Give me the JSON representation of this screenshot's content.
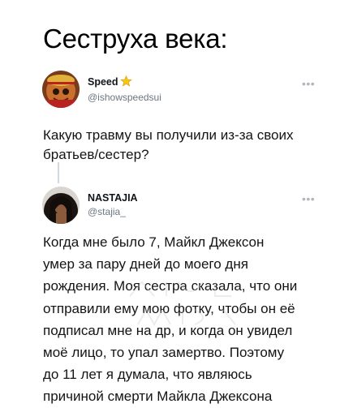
{
  "page": {
    "title": "Сеструха века:"
  },
  "post_1": {
    "display_name": "Speed",
    "badge_icon": "star-badge-icon",
    "handle": "@ishowspeedsui",
    "more_icon": "ellipsis-icon",
    "text_lines": [
      "Какую травму вы получили из-за своих",
      "братьев/сестер?"
    ]
  },
  "post_2": {
    "display_name": "NASTAJIA",
    "handle": "@stajia_",
    "more_icon": "ellipsis-icon",
    "text_lines": [
      "Когда мне было 7, Майкл Джексон",
      "умер за пару дней до моего дня",
      "рождения. Моя сестра сказала, что они",
      "отправили ему мою фотку, чтобы он её",
      "подписал мне на др, и когда он увидел",
      "моё лицо, то упал замертво. Поэтому",
      "до 11 лет я думала, что являюсь",
      "причиной смерти Майкла Джексона"
    ]
  },
  "colors": {
    "text": "#0f1419",
    "handle": "#6b7680",
    "badge_gold": "#f5c518",
    "thread_line": "#cfd9de"
  }
}
